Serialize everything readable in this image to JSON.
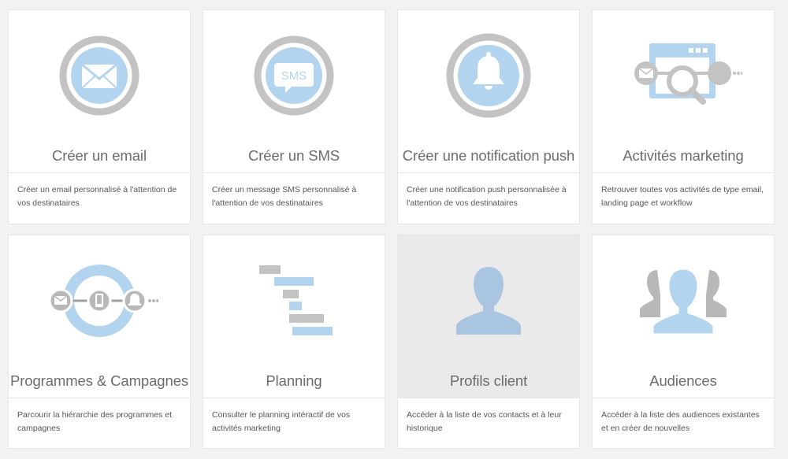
{
  "cards": [
    {
      "title": "Créer un email",
      "description": "Créer un email personnalisé à l'attention de vos destinataires",
      "icon": "envelope-icon"
    },
    {
      "title": "Créer un SMS",
      "description": "Créer un message SMS personnalisé à l'attention de vos destinataires",
      "icon": "sms-icon",
      "icon_text": "SMS"
    },
    {
      "title": "Créer une notification push",
      "description": "Créer une notification push personnalisée à l'attention de vos destinataires",
      "icon": "bell-icon"
    },
    {
      "title": "Activités marketing",
      "description": "Retrouver toutes vos activités de type email, landing page et workflow",
      "icon": "marketing-search-icon"
    },
    {
      "title": "Programmes & Campagnes",
      "description": "Parcourir la hiérarchie des programmes et campagnes",
      "icon": "campaign-cycle-icon"
    },
    {
      "title": "Planning",
      "description": "Consulter le planning intéractif de vos activités marketing",
      "icon": "gantt-chart-icon"
    },
    {
      "title": "Profils client",
      "description": "Accéder à la liste de vos contacts et à leur historique",
      "icon": "person-silhouette-icon"
    },
    {
      "title": "Audiences",
      "description": "Accéder à la liste des audiences existantes et en créer de nouvelles",
      "icon": "group-silhouette-icon"
    }
  ],
  "colors": {
    "accent": "#b3d4ef",
    "gray": "#c3c3c3",
    "gray_dark": "#b0b0b0",
    "person": "#a9c5e0"
  }
}
